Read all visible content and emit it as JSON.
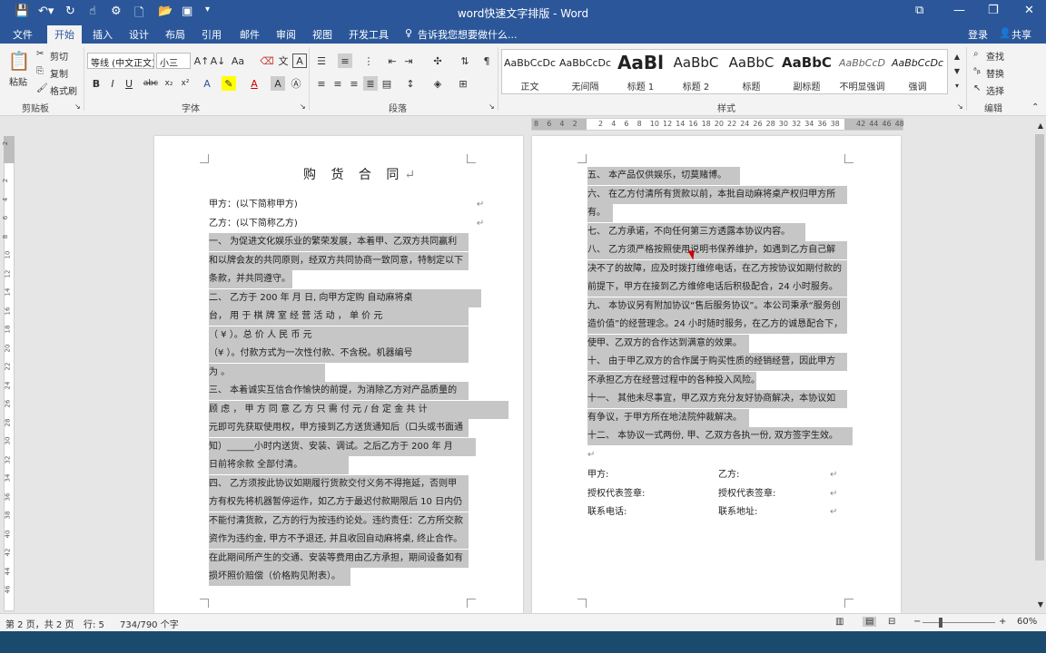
{
  "titlebar": {
    "doc_title": "word快速文字排版 - Word",
    "qa_save": "💾",
    "window_restore": "⧉",
    "window_min": "—",
    "window_max": "❐",
    "window_close": "✕"
  },
  "tabs": [
    {
      "label": "文件"
    },
    {
      "label": "开始"
    },
    {
      "label": "插入"
    },
    {
      "label": "设计"
    },
    {
      "label": "布局"
    },
    {
      "label": "引用"
    },
    {
      "label": "邮件"
    },
    {
      "label": "审阅"
    },
    {
      "label": "视图"
    },
    {
      "label": "开发工具"
    }
  ],
  "tell_me": "告诉我您想要做什么...",
  "login": "登录",
  "share": "共享",
  "ribbon": {
    "clipboard": {
      "paste": "粘贴",
      "cut": "剪切",
      "copy": "复制",
      "format_painter": "格式刷",
      "group": "剪贴板"
    },
    "font": {
      "font_name": "等线 (中文正文)",
      "font_size": "小三",
      "group": "字体"
    },
    "paragraph": {
      "group": "段落"
    },
    "styles": {
      "group": "样式",
      "items": [
        {
          "preview": "AaBbCcDc",
          "name": "正文"
        },
        {
          "preview": "AaBbCcDc",
          "name": "无间隔"
        },
        {
          "preview": "AaBl",
          "name": "标题 1"
        },
        {
          "preview": "AaBbC",
          "name": "标题 2"
        },
        {
          "preview": "AaBbC",
          "name": "标题"
        },
        {
          "preview": "AaBbC",
          "name": "副标题"
        },
        {
          "preview": "AaBbCcD",
          "name": "不明显强调"
        },
        {
          "preview": "AaBbCcDc",
          "name": "强调"
        }
      ]
    },
    "editing": {
      "find": "查找",
      "replace": "替换",
      "select": "选择",
      "group": "编辑"
    }
  },
  "ruler_numbers": [
    "8",
    "6",
    "4",
    "2",
    "",
    "2",
    "4",
    "6",
    "8",
    "10",
    "12",
    "14",
    "16",
    "18",
    "20",
    "22",
    "24",
    "26",
    "28",
    "30",
    "32",
    "34",
    "36",
    "38",
    "",
    "42",
    "44",
    "46",
    "48"
  ],
  "vruler_numbers": [
    "2",
    "",
    "2",
    "4",
    "6",
    "8",
    "10",
    "12",
    "14",
    "16",
    "18",
    "20",
    "22",
    "24",
    "26",
    "28",
    "30",
    "32",
    "34",
    "36",
    "38",
    "40",
    "42",
    "44",
    "46"
  ],
  "page1": {
    "title": "购 货 合 同",
    "lines": [
      "甲方：(以下简称甲方)",
      "乙方：(以下简称乙方)",
      "一、   为促进文化娱乐业的繁荣发展，本着甲、乙双方共同赢利",
      "和以牌会友的共同原则，经双方共同协商一致同意，特制定以下",
      "条款，并共同遵守。",
      "二、   乙方于 200     年   月   日, 向甲方定购             自动麻将桌",
      "台，  用 于 棋 牌 室 经 营 活 动 ，  单  价                             元",
      "（ ¥                                      ）。总 价 人 民 币                    元",
      "（¥               ）。付款方式为一次性付款、不含税。机器编号",
      "为                              。",
      "三、   本着诚实互信合作愉快的前提，为消除乙方对产品质量的",
      "顾 虑 ， 甲 方 同 意 乙 方 只 需 付                        元 / 台 定 金 共 计",
      "元即可先获取使用权，甲方接到乙方送货通知后（口头或书面通",
      "知）______小时内送货、安装、调试。之后乙方于  200     年     月",
      "日前将余款                全部付清。",
      "四、   乙方须按此协议如期履行货款交付义务不得拖延，否则甲",
      "方有权先将机器暂停运作，如乙方于最迟付款期限后 10 日内仍",
      "不能付清货款，乙方的行为按违约论处。违约责任：乙方所交款",
      "资作为违约金, 甲方不予退还, 并且收回自动麻将桌, 终止合作。",
      "在此期间所产生的交通、安装等费用由乙方承担，期间设备如有",
      "损坏照价赔偿（价格购见附表）。"
    ]
  },
  "page2": {
    "lines": [
      "五、   本产品仅供娱乐，切莫赌博。",
      "六、   在乙方付清所有货款以前，本批自动麻将桌产权归甲方所",
      "有。",
      "七、   乙方承诺，不向任何第三方透露本协议内容。",
      "八、   乙方须严格按照使用说明书保养维护，如遇到乙方自己解",
      "决不了的故障，应及时拨打维修电话，在乙方按协议如期付款的",
      "前提下，甲方在接到乙方维修电话后积极配合，24 小时服务。",
      "九、   本协议另有附加协议“售后服务协议”。本公司秉承“服务创",
      "造价值”的经营理念。24 小时随时服务，在乙方的诚恳配合下，",
      "使甲、乙双方的合作达到满意的效果。",
      "十、   由于甲乙双方的合作属于购买性质的经销经营，因此甲方",
      "不承担乙方在经营过程中的各种投入风险。",
      "十一、      其他未尽事宜，甲乙双方充分友好协商解决，本协议如",
      "有争议，于甲方所在地法院仲裁解决。",
      "十二、      本协议一式两份, 甲、乙双方各执一份, 双方签字生效。"
    ],
    "sign": [
      {
        "left": "甲方:",
        "right": "乙方:"
      },
      {
        "left": "授权代表签章:",
        "right": "授权代表签章:"
      },
      {
        "left": "联系电话:",
        "right": "联系地址:"
      }
    ]
  },
  "status": {
    "page": "第 2 页，共 2 页",
    "line": "行: 5",
    "words": "734/790 个字",
    "zoom": "60%"
  }
}
